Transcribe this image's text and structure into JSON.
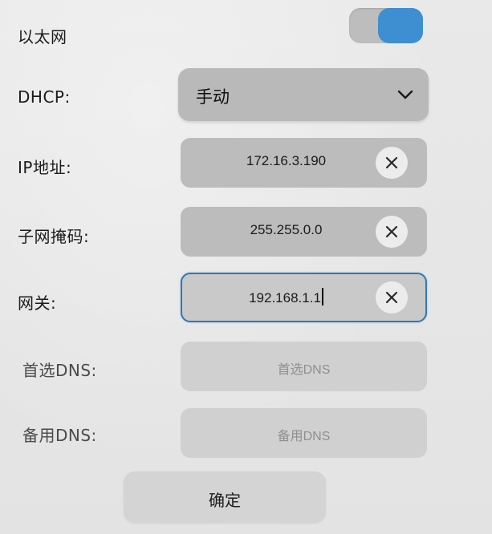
{
  "ethernet": {
    "label": "以太网",
    "enabled": true
  },
  "dhcp": {
    "label": "DHCP:",
    "selected": "手动"
  },
  "fields": {
    "ip": {
      "label": "IP地址:",
      "value": "172.16.3.190"
    },
    "mask": {
      "label": "子网掩码:",
      "value": "255.255.0.0"
    },
    "gateway": {
      "label": "网关:",
      "value": "192.168.1.1"
    },
    "dns1": {
      "label": "首选DNS:",
      "placeholder": "首选DNS"
    },
    "dns2": {
      "label": "备用DNS:",
      "placeholder": "备用DNS"
    }
  },
  "confirm_label": "确定",
  "icons": {
    "dropdown": "chevron-down-icon",
    "clear": "clear-icon"
  },
  "colors": {
    "accent": "#3d8fd1",
    "focus_border": "#2e79b8"
  }
}
